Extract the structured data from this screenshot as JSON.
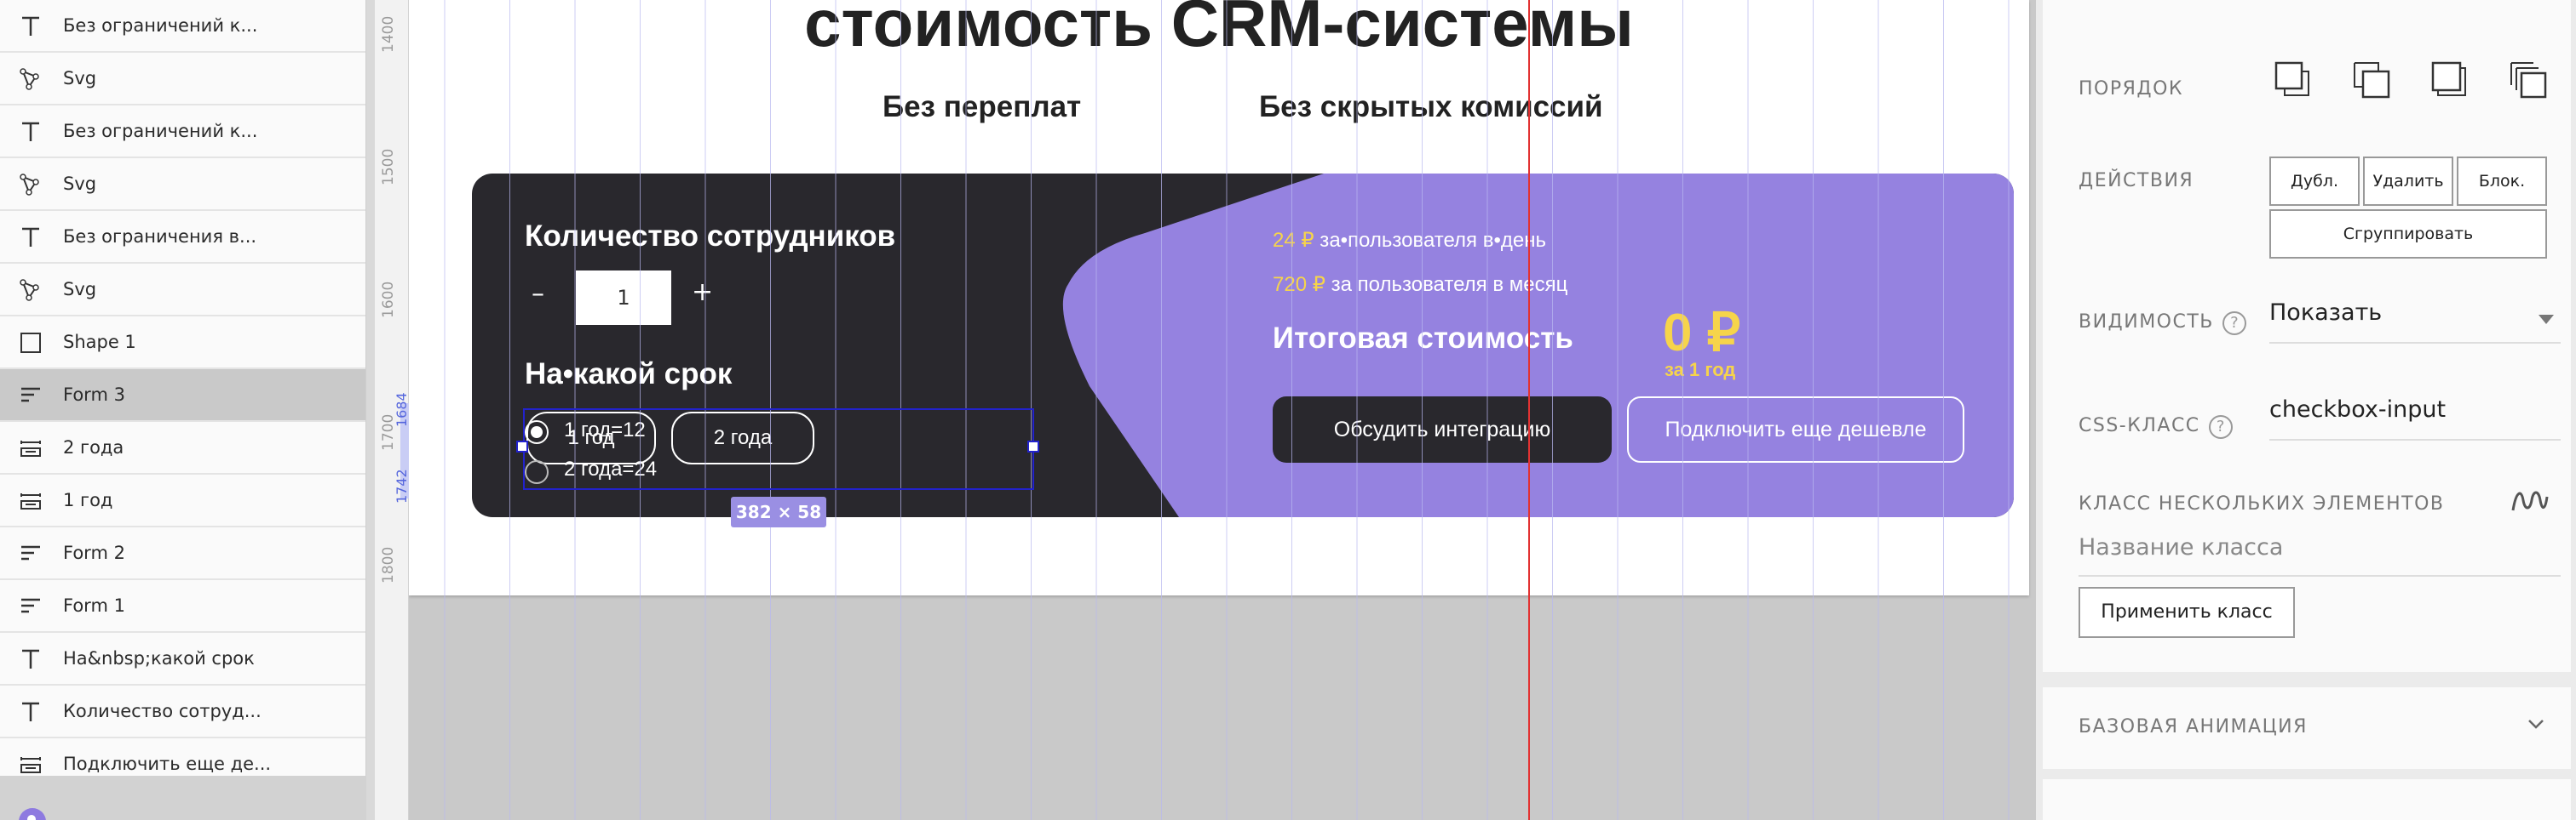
{
  "layers": [
    {
      "icon": "text-icon",
      "label": "Без ограничений к..."
    },
    {
      "icon": "vector-icon",
      "label": "Svg"
    },
    {
      "icon": "text-icon",
      "label": "Без ограничений к..."
    },
    {
      "icon": "vector-icon",
      "label": "Svg"
    },
    {
      "icon": "text-icon",
      "label": "Без ограничения в..."
    },
    {
      "icon": "vector-icon",
      "label": "Svg"
    },
    {
      "icon": "shape-icon",
      "label": "Shape 1"
    },
    {
      "icon": "form-icon",
      "label": "Form 3",
      "selected": true
    },
    {
      "icon": "form-field-icon",
      "label": "2 года"
    },
    {
      "icon": "form-field-icon",
      "label": "1 год"
    },
    {
      "icon": "form-icon",
      "label": "Form 2"
    },
    {
      "icon": "form-icon",
      "label": "Form 1"
    },
    {
      "icon": "text-icon",
      "label": "Ha&nbsp;какой срок"
    },
    {
      "icon": "text-icon",
      "label": "Количество сотруд..."
    },
    {
      "icon": "form-field-icon",
      "label": "Подключить еще де..."
    }
  ],
  "ruler": {
    "ticks": [
      "1400",
      "1500",
      "1600",
      "1700",
      "1800"
    ],
    "selection_start": "1684",
    "selection_end": "1742"
  },
  "canvas": {
    "heading": "стоимость CRM-системы",
    "subheading_left": "Без переплат",
    "subheading_right": "Без скрытых комиссий",
    "calc": {
      "employees_title": "Количество сотрудников",
      "minus": "–",
      "qty_value": "1",
      "plus": "+",
      "term_title": "На•какой срок",
      "pill_1": "1 год",
      "pill_2": "2 года",
      "radio_1": "1 год=12",
      "radio_2": "2 года=24",
      "price_day_amount": "24 ₽",
      "price_day_text": " за•пользователя в•день",
      "price_month_amount": "720 ₽",
      "price_month_text": " за пользователя в месяц",
      "total_label": "Итоговая стоимость",
      "total_value": "0 ₽",
      "total_period": "за 1 год",
      "btn_discuss": "Обсудить интеграцию",
      "btn_cheaper": "Подключить еще дешевле"
    },
    "selection_size": "382 × 58"
  },
  "props": {
    "order_label": "ПОРЯДОК",
    "actions_label": "ДЕЙСТВИЯ",
    "btn_duplicate": "Дубл.",
    "btn_delete": "Удалить",
    "btn_block": "Блок.",
    "btn_group": "Сгруппировать",
    "visibility_label": "ВИДИМОСТЬ",
    "visibility_value": "Показать",
    "help_glyph": "?",
    "css_class_label": "CSS-КЛАСС",
    "css_class_value": "checkbox-input",
    "multi_class_label": "КЛАСС НЕСКОЛЬКИХ ЭЛЕМЕНТОВ",
    "class_name_placeholder": "Название класса",
    "apply_class_button": "Применить класс",
    "base_animation_label": "БАЗОВАЯ АНИМАЦИЯ"
  },
  "colors": {
    "accent_purple": "#9582e0",
    "dark_card": "#29282d",
    "price_yellow": "#f6d44b",
    "selection_blue": "#2222cc",
    "guide_red": "#e23232"
  }
}
